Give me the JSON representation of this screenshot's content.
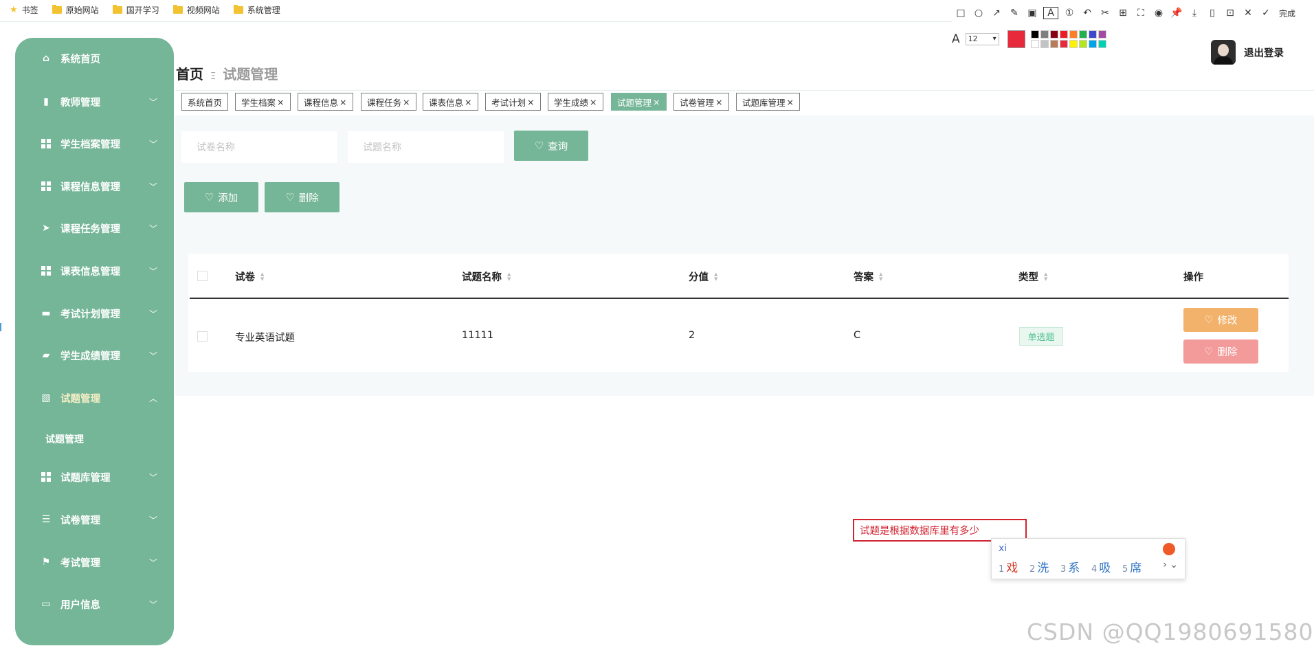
{
  "bookmarks": [
    "书签",
    "原始网站",
    "国开学习",
    "视频网站",
    "系统管理"
  ],
  "screenshot_tool": {
    "tool_icons": [
      "rectangle-icon",
      "circle-icon",
      "arrow-icon",
      "pen-icon",
      "mosaic-icon",
      "text-icon",
      "number-icon",
      "undo-icon",
      "cut-icon",
      "ocr-icon",
      "capture-icon",
      "record-icon",
      "pin-icon",
      "download-icon",
      "phone-icon",
      "bookmark-icon",
      "close-icon"
    ],
    "done_label": "完成",
    "font_size": "12",
    "current_color": "#e8293b",
    "palette": [
      "#000000",
      "#7f7f7f",
      "#880015",
      "#ed1c24",
      "#ff7f27",
      "#22b14c",
      "#3f48cc",
      "#a349a4",
      "#ffffff",
      "#c3c3c3",
      "#b97a57",
      "#e8293b",
      "#fff200",
      "#b5e61d",
      "#00a2e8",
      "#00d2b4"
    ]
  },
  "sidebar": {
    "items": [
      {
        "label": "系统首页",
        "icon": "home-icon",
        "expanded": null
      },
      {
        "label": "教师管理",
        "icon": "clipboard-icon",
        "expanded": false
      },
      {
        "label": "学生档案管理",
        "icon": "grid-icon",
        "expanded": false
      },
      {
        "label": "课程信息管理",
        "icon": "grid-icon",
        "expanded": false
      },
      {
        "label": "课程任务管理",
        "icon": "send-icon",
        "expanded": false
      },
      {
        "label": "课表信息管理",
        "icon": "grid-icon",
        "expanded": false
      },
      {
        "label": "考试计划管理",
        "icon": "printer-icon",
        "expanded": false
      },
      {
        "label": "学生成绩管理",
        "icon": "briefcase-icon",
        "expanded": false
      },
      {
        "label": "试题管理",
        "icon": "chart-icon",
        "expanded": true
      },
      {
        "label": "试题库管理",
        "icon": "grid-icon",
        "expanded": false
      },
      {
        "label": "试卷管理",
        "icon": "sliders-icon",
        "expanded": false
      },
      {
        "label": "考试管理",
        "icon": "flag-icon",
        "expanded": false
      },
      {
        "label": "用户信息",
        "icon": "card-icon",
        "expanded": false
      }
    ],
    "sub_item": "试题管理"
  },
  "header": {
    "breadcrumb_home": "首页",
    "breadcrumb_sep": "Ξ",
    "breadcrumb_current": "试题管理",
    "logout": "退出登录"
  },
  "tabs": [
    {
      "label": "系统首页",
      "closable": false
    },
    {
      "label": "学生档案",
      "closable": true
    },
    {
      "label": "课程信息",
      "closable": true
    },
    {
      "label": "课程任务",
      "closable": true
    },
    {
      "label": "课表信息",
      "closable": true
    },
    {
      "label": "考试计划",
      "closable": true
    },
    {
      "label": "学生成绩",
      "closable": true
    },
    {
      "label": "试题管理",
      "closable": true,
      "active": true
    },
    {
      "label": "试卷管理",
      "closable": true
    },
    {
      "label": "试题库管理",
      "closable": true
    }
  ],
  "search": {
    "placeholder1": "试卷名称",
    "placeholder2": "试题名称",
    "query_label": "查询"
  },
  "actions": {
    "add_label": "添加",
    "delete_label": "删除"
  },
  "table": {
    "columns": [
      "试卷",
      "试题名称",
      "分值",
      "答案",
      "类型",
      "操作"
    ],
    "rows": [
      {
        "paper": "专业英语试题",
        "name": "11111",
        "score": "2",
        "answer": "C",
        "type": "单选题",
        "edit": "修改",
        "delete": "删除"
      }
    ]
  },
  "annotation": {
    "text": "试题是根据数据库里有多少"
  },
  "ime": {
    "input": "xi",
    "candidates": [
      {
        "n": "1",
        "c": "戏"
      },
      {
        "n": "2",
        "c": "洗"
      },
      {
        "n": "3",
        "c": "系"
      },
      {
        "n": "4",
        "c": "吸"
      },
      {
        "n": "5",
        "c": "席"
      }
    ]
  },
  "watermark": "CSDN @QQ1980691580",
  "colors": {
    "accent": "#76b698",
    "edit": "#f3b26b",
    "danger": "#f39a9a"
  }
}
